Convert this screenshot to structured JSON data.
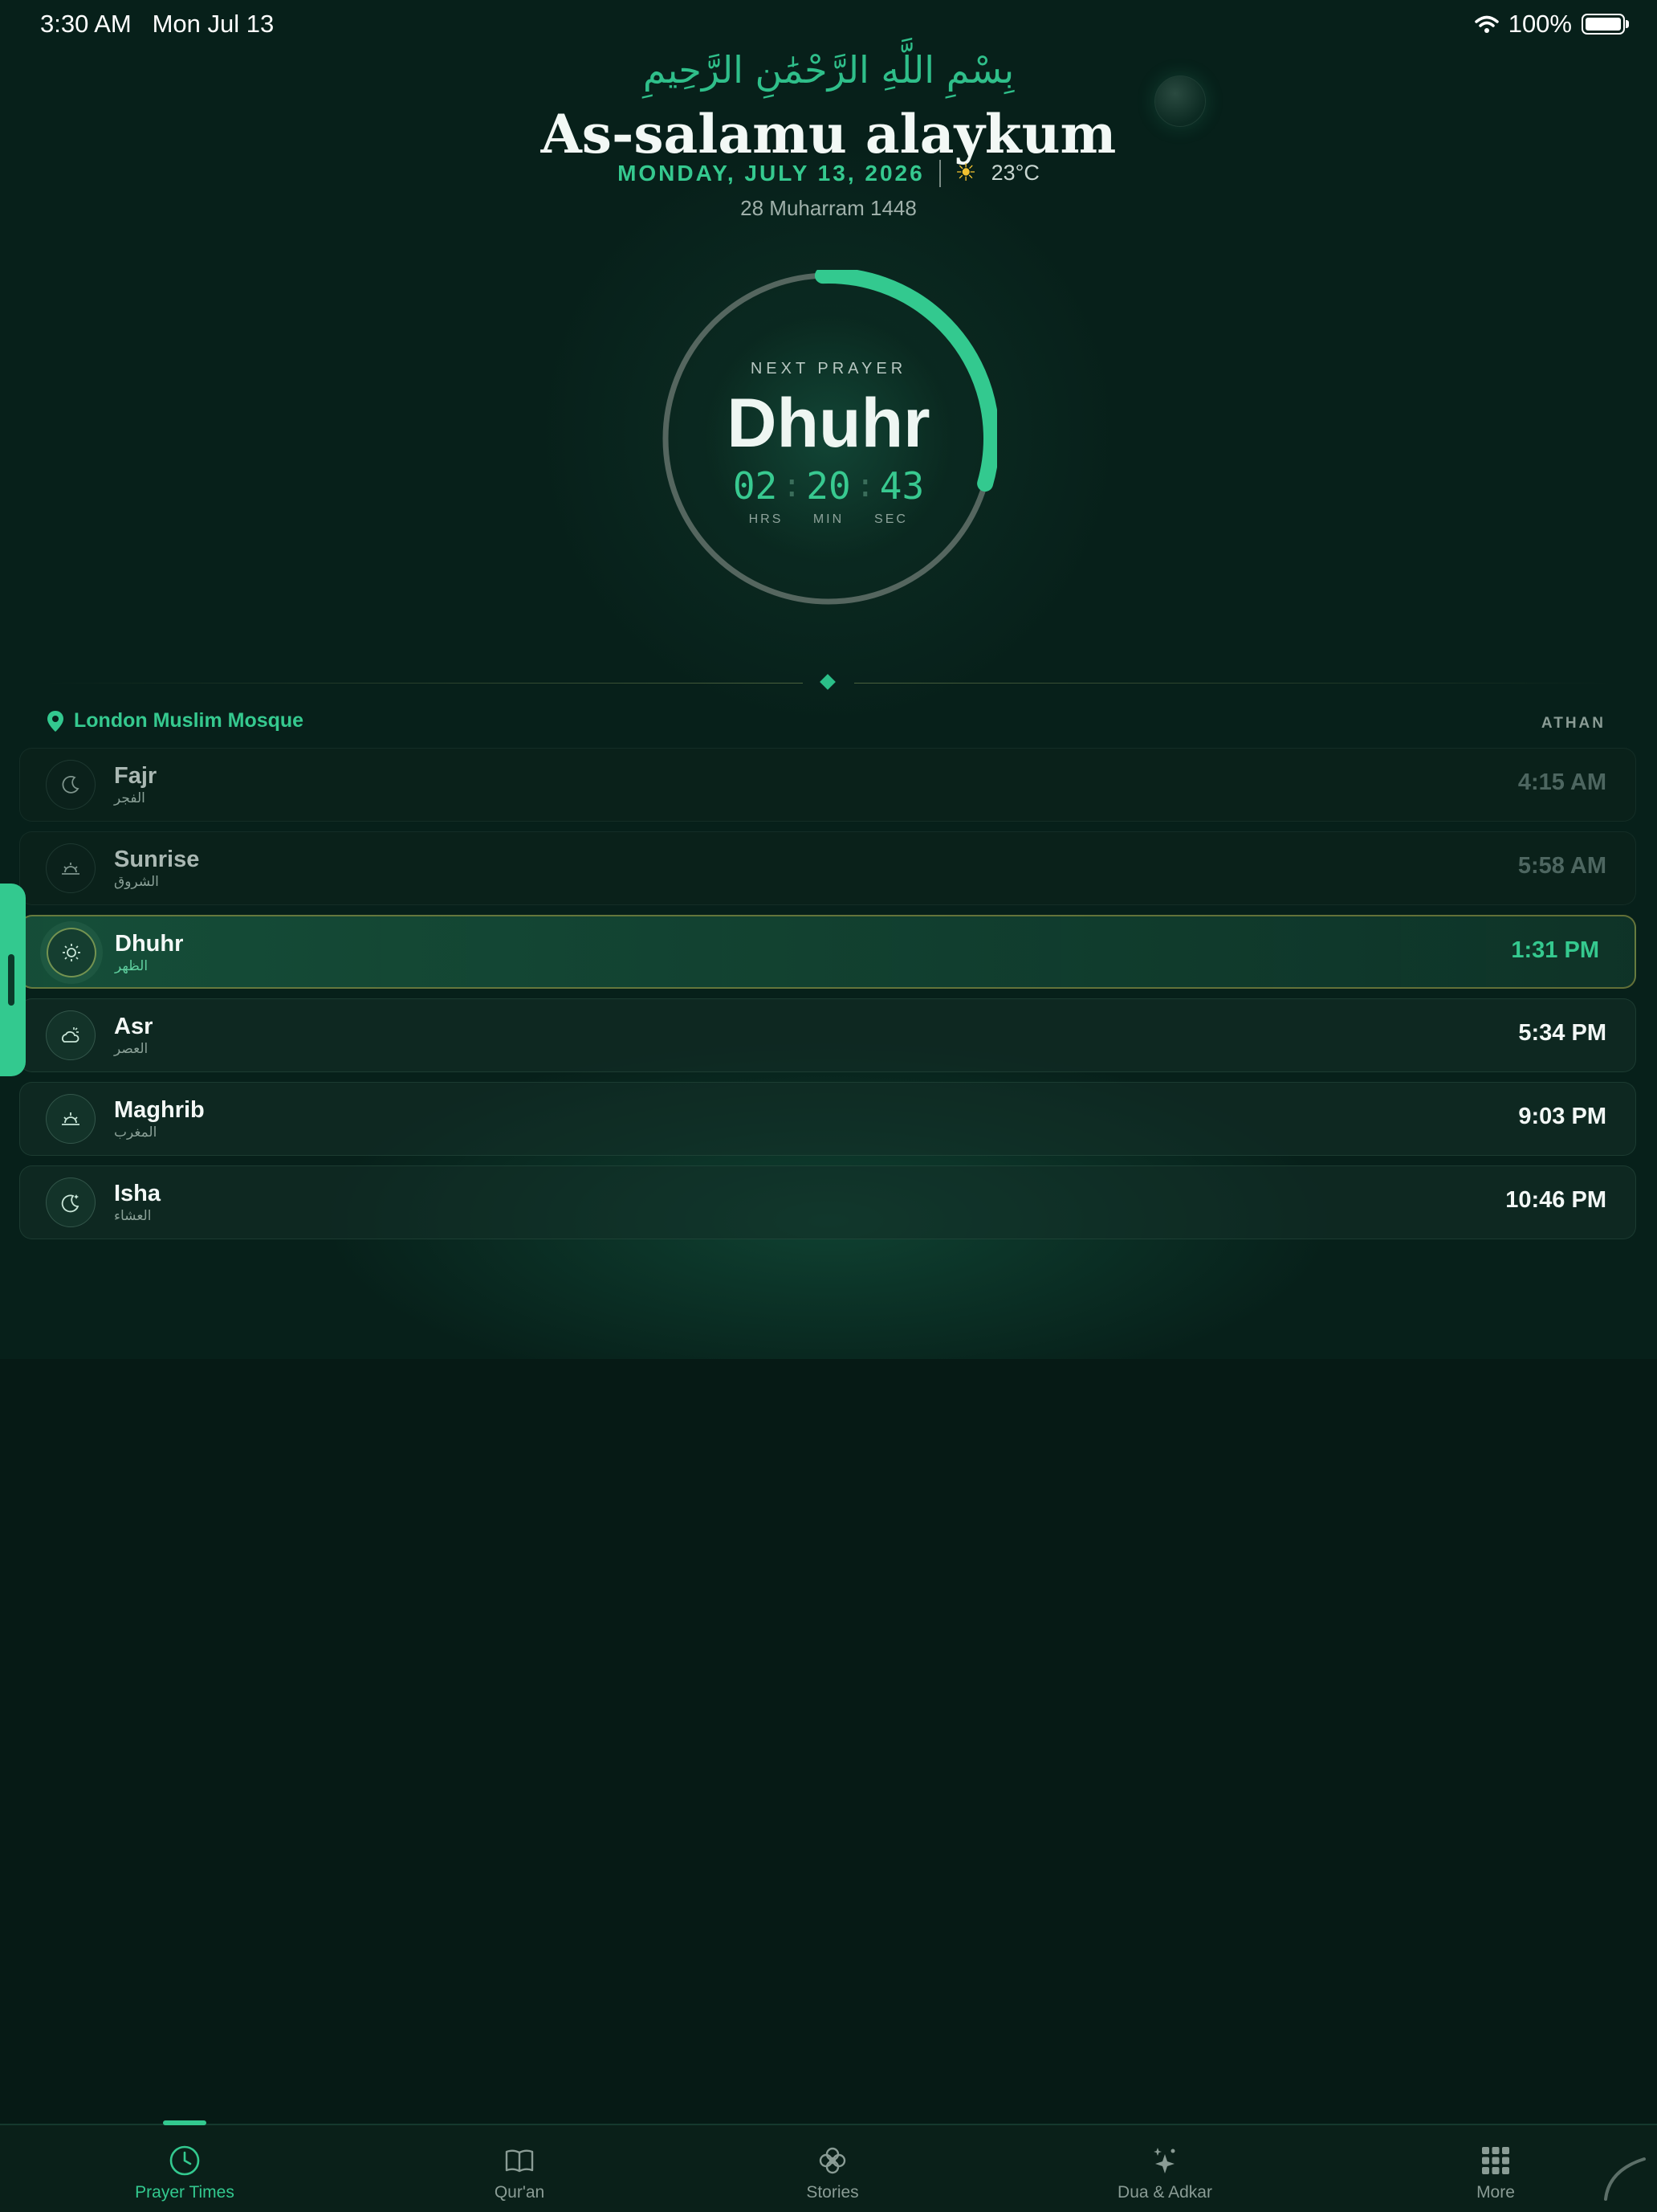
{
  "status_bar": {
    "time": "3:30 AM",
    "date": "Mon Jul 13",
    "battery": "100%"
  },
  "header": {
    "basmala": "بِسْمِ اللَّهِ الرَّحْمَٰنِ الرَّحِيمِ",
    "greeting": "As-salamu alaykum",
    "date": "MONDAY, JULY 13, 2026",
    "weather_icon": "sun-icon",
    "temperature": "23°C",
    "hijri_date": "28 Muharram 1448"
  },
  "next_prayer": {
    "label": "NEXT PRAYER",
    "name": "Dhuhr",
    "hours": "02",
    "minutes": "20",
    "seconds": "43",
    "unit_hours": "HRS",
    "unit_minutes": "MIN",
    "unit_seconds": "SEC",
    "progress_fraction": 0.3
  },
  "location": {
    "name": "London Muslim Mosque",
    "column_header": "ATHAN"
  },
  "prayers": [
    {
      "name": "Fajr",
      "arabic": "الفجر",
      "time": "4:15 AM",
      "icon": "moon-icon",
      "state": "past"
    },
    {
      "name": "Sunrise",
      "arabic": "الشروق",
      "time": "5:58 AM",
      "icon": "sunrise-icon",
      "state": "past"
    },
    {
      "name": "Dhuhr",
      "arabic": "الظهر",
      "time": "1:31 PM",
      "icon": "sun-icon",
      "state": "next"
    },
    {
      "name": "Asr",
      "arabic": "العصر",
      "time": "5:34 PM",
      "icon": "cloud-sun-icon",
      "state": "upcoming"
    },
    {
      "name": "Maghrib",
      "arabic": "المغرب",
      "time": "9:03 PM",
      "icon": "sunset-icon",
      "state": "upcoming"
    },
    {
      "name": "Isha",
      "arabic": "العشاء",
      "time": "10:46 PM",
      "icon": "moon-star-icon",
      "state": "upcoming"
    }
  ],
  "tabs": [
    {
      "label": "Prayer Times",
      "icon": "clock-icon",
      "active": true
    },
    {
      "label": "Qur'an",
      "icon": "book-icon",
      "active": false
    },
    {
      "label": "Stories",
      "icon": "flower-icon",
      "active": false
    },
    {
      "label": "Dua & Adkar",
      "icon": "sparkles-icon",
      "active": false
    },
    {
      "label": "More",
      "icon": "grid-icon",
      "active": false
    }
  ],
  "colors": {
    "background": "#061a15",
    "accent": "#33c98f",
    "highlight_border": "#aaa046"
  }
}
